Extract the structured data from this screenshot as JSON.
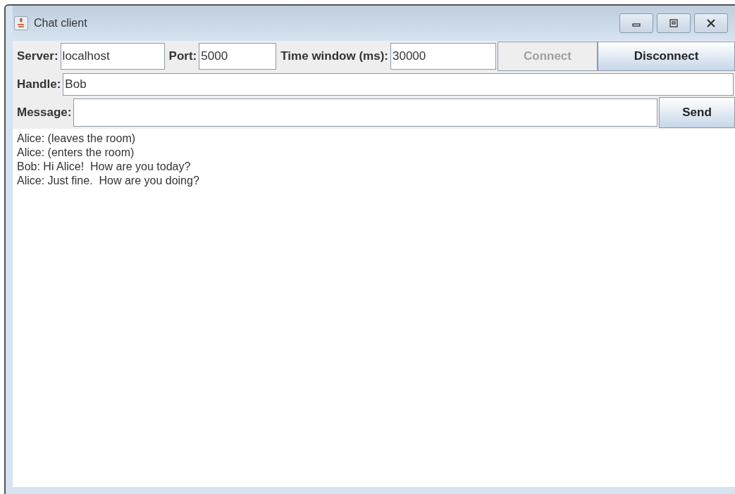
{
  "window": {
    "title": "Chat client"
  },
  "connection": {
    "fields": [
      {
        "label": "Server:",
        "value": "localhost"
      },
      {
        "label": "Port:",
        "value": "5000"
      },
      {
        "label": "Time window (ms):",
        "value": "30000"
      }
    ],
    "buttons": [
      {
        "label": "Connect",
        "disabled": true
      },
      {
        "label": "Disconnect",
        "disabled": false
      }
    ]
  },
  "handle": {
    "label": "Handle:",
    "value": "Bob"
  },
  "message": {
    "label": "Message:",
    "send_label": "Send"
  },
  "messages": [
    "Alice: (leaves the room)",
    "Alice: (enters the room)",
    "Bob: Hi Alice!  How are you today?",
    "Alice: Just fine.  How are you doing?"
  ]
}
